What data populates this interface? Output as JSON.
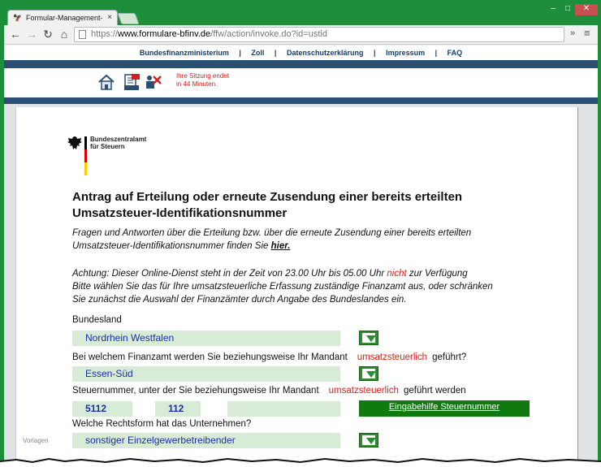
{
  "browser": {
    "tab_title": "Formular-Management-S",
    "tab_close": "×",
    "url_scheme": "https://",
    "url_host": "www.formulare-bfinv.de",
    "url_path": "/ffw/action/invoke.do?id=ustid",
    "overflow_label": "»",
    "menu_label": "≡"
  },
  "topnav": {
    "items": [
      "Bundesfinanzministerium",
      "Zoll",
      "Datenschutzerklärung",
      "Impressum",
      "FAQ"
    ],
    "separator": "|"
  },
  "session": {
    "line1": "Ihre Sitzung endet",
    "line2": "in 44 Minuten."
  },
  "logo": {
    "line1": "Bundeszentralamt",
    "line2": "für Steuern"
  },
  "form": {
    "title_line1": "Antrag auf Erteilung oder erneute Zusendung einer bereits erteilten",
    "title_line2": "Umsatzsteuer-Identifikationsnummer",
    "intro_line1": "Fragen und Antworten über die Erteilung bzw. über die erneute Zusendung einer bereits erteilten",
    "intro_line2": "Umsatzsteuer-Identifikationsnummer finden Sie",
    "intro_link": "hier.",
    "warn_text_before": "Achtung: Dieser Online-Dienst steht in der Zeit von 23.00 Uhr bis 05.00 Uhr",
    "warn_red": "nicht",
    "warn_text_after": "zur Verfügung",
    "warn_line2": "Bitte wählen Sie das für Ihre umsatzsteuerliche Erfassung zuständige Finanzamt aus, oder schränken",
    "warn_line3": "Sie zunächst die Auswahl der Finanzämter durch Angabe des Bundeslandes ein.",
    "bundesland_label": "Bundesland",
    "bundesland_value": "Nordrhein Westfalen",
    "finanzamt_label_before": "Bei welchem Finanzamt werden Sie beziehungsweise Ihr Mandant",
    "finanzamt_label_red": "umsatzsteuerlich",
    "finanzamt_label_after": "geführt?",
    "finanzamt_value": "Essen-Süd",
    "steuernr_label_before": "Steuernummer, unter der Sie beziehungsweise Ihr Mandant",
    "steuernr_label_red": "umsatzsteuerlich",
    "steuernr_label_after": "geführt werden",
    "steuernr_part1": "5112",
    "steuernr_part2": "112",
    "steuernr_part3": "",
    "help_button": "Eingabehilfe Steuernummer",
    "rechtsform_label": "Welche Rechtsform hat das Unternehmen?",
    "rechtsform_value": "sonstiger Einzelgewerbetreibender"
  },
  "watermark": "Vorlagen",
  "colors": {
    "frame_green": "#1d8f3a",
    "nav_blue": "#2a4f75",
    "field_bg": "#d7ebd7",
    "field_text": "#1a2fa8",
    "accent_red": "#e0201a",
    "button_green": "#107a10"
  },
  "icons": [
    "home-icon",
    "pdf-print-icon",
    "close-form-icon",
    "back-arrow-icon",
    "forward-arrow-icon",
    "reload-icon",
    "home-nav-icon",
    "page-icon",
    "dropdown-icon"
  ]
}
